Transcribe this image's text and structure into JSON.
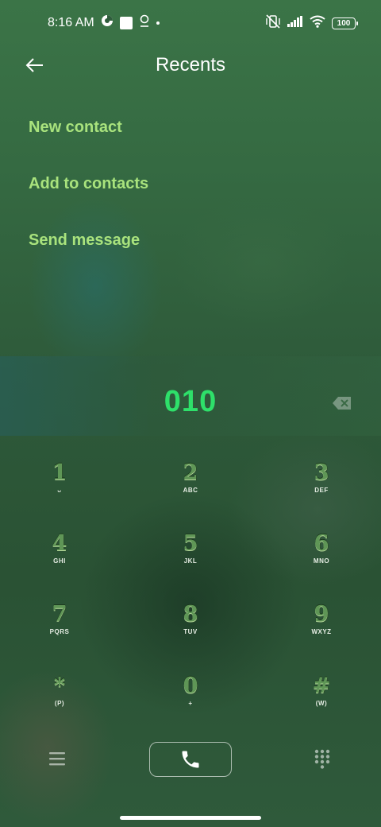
{
  "status_bar": {
    "time": "8:16 AM",
    "battery": "100",
    "icons": [
      "data-saver-icon",
      "square-notification-icon",
      "location-icon",
      "dot-icon",
      "vibrate-off-icon",
      "signal-icon",
      "wifi-icon",
      "battery-icon"
    ]
  },
  "header": {
    "title": "Recents",
    "back_icon": "arrow-left-icon"
  },
  "menu": {
    "items": [
      {
        "label": "New contact"
      },
      {
        "label": "Add to contacts"
      },
      {
        "label": "Send message"
      }
    ]
  },
  "dialer": {
    "number": "010",
    "backspace_icon": "backspace-icon"
  },
  "keypad": {
    "keys": [
      {
        "digit": "1",
        "letters": "ᴗ"
      },
      {
        "digit": "2",
        "letters": "ABC"
      },
      {
        "digit": "3",
        "letters": "DEF"
      },
      {
        "digit": "4",
        "letters": "GHI"
      },
      {
        "digit": "5",
        "letters": "JKL"
      },
      {
        "digit": "6",
        "letters": "MNO"
      },
      {
        "digit": "7",
        "letters": "PQRS"
      },
      {
        "digit": "8",
        "letters": "TUV"
      },
      {
        "digit": "9",
        "letters": "WXYZ"
      },
      {
        "digit": "*",
        "letters": "(P)"
      },
      {
        "digit": "0",
        "letters": "+"
      },
      {
        "digit": "#",
        "letters": "(W)"
      }
    ]
  },
  "bottom_bar": {
    "menu_icon": "hamburger-icon",
    "call_icon": "phone-icon",
    "dialpad_icon": "dialpad-icon"
  },
  "colors": {
    "accent_green": "#a9e37d",
    "number_green": "#2ee06a"
  }
}
